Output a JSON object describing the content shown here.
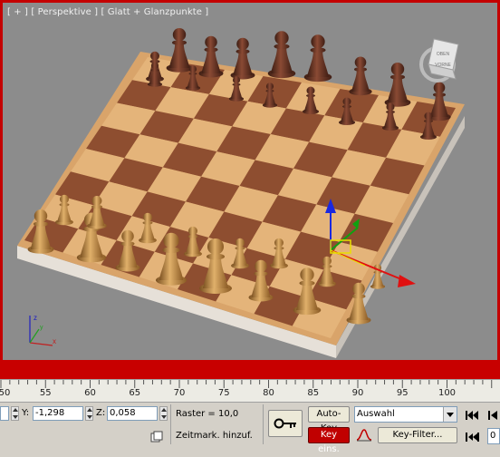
{
  "viewport": {
    "label": "[ + ] [ Perspektive ] [ Glatt + Glanzpunkte ]",
    "viewcube": {
      "top": "OBEN",
      "front": "VORNE"
    },
    "border_color": "#c40000"
  },
  "timeline": {
    "ruler_labels": [
      "50",
      "55",
      "60",
      "65",
      "70",
      "75",
      "80",
      "85",
      "90",
      "95",
      "100"
    ]
  },
  "status": {
    "y_label": "Y:",
    "y_value": "-1,298",
    "z_label": "Z:",
    "z_value": "0,058",
    "grid_text": "Raster = 10,0",
    "add_time_tag": "Zeitmark. hinzuf."
  },
  "animation": {
    "auto_key_label": "Auto-Key",
    "set_key_label": "Key eins.",
    "selection_value": "Auswahl",
    "key_filter_label": "Key-Filter...",
    "frame_value": "0",
    "key_mode_color": "#c00000"
  },
  "icons": [
    "key-icon",
    "time-tag-icon",
    "curve-icon",
    "goto-start-icon",
    "prev-frame-icon",
    "dropdown-arrow-icon"
  ]
}
